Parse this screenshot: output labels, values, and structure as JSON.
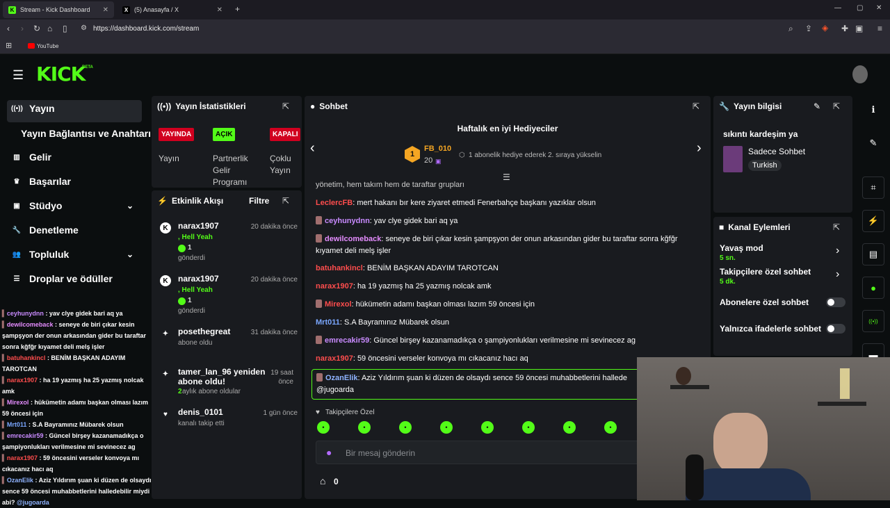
{
  "browser": {
    "tabs": [
      {
        "label": "Stream - Kick Dashboard",
        "fav": "K"
      },
      {
        "label": "(5) Anasayfa / X",
        "fav": "X"
      }
    ],
    "url": "https://dashboard.kick.com/stream",
    "bookmark": "YouTube"
  },
  "logo": "KICK",
  "logo_beta": "BETA",
  "nav": [
    {
      "label": "Yayın",
      "icon": "broadcast-icon"
    },
    {
      "label": "Yayın Bağlantısı ve Anahtarı",
      "icon": ""
    },
    {
      "label": "Gelir",
      "icon": "chart-icon"
    },
    {
      "label": "Başarılar",
      "icon": "trophy-icon"
    },
    {
      "label": "Stüdyo",
      "icon": "studio-icon"
    },
    {
      "label": "Denetleme",
      "icon": "wrench-icon"
    },
    {
      "label": "Topluluk",
      "icon": "people-icon"
    },
    {
      "label": "Droplar ve ödüller",
      "icon": "drops-icon"
    }
  ],
  "side_chat": [
    {
      "name": "ceyhunydnn",
      "text": " : yav clye gidek bari aq ya",
      "color": "u-purple"
    },
    {
      "name": "dewilcomeback",
      "text": " : seneye de biri çıkar kesin şampşyon der onun arkasından gider bu taraftar sonra kğfğr kıyamet deli melş işler",
      "color": "u-pink"
    },
    {
      "name": "batuhankincl",
      "text": " : BENİM BAŞKAN ADAYIM TAROTCAN",
      "color": "u-red"
    },
    {
      "name": "narax1907",
      "text": " : ha 19 yazmış ha 25 yazmış nolcak amk",
      "color": "u-red"
    },
    {
      "name": "Mirexol",
      "text": " : hükümetin adamı başkan olması lazım 59 öncesi için",
      "color": "u-pink"
    },
    {
      "name": "Mrt011",
      "text": " : S.A Bayramınız Mübarek olsun",
      "color": "u-blue"
    },
    {
      "name": "emrecakir59",
      "text": " : Güncel birşey kazanamadıkça o şampiyonlukları verilmesine mi sevinecez ag",
      "color": "u-purple"
    },
    {
      "name": "narax1907",
      "text": " : 59 öncesini verseler konvoya mı cıkacanız hacı aq",
      "color": "u-red"
    },
    {
      "name": "OzanElik",
      "text": " : Aziz Yıldırım şuan ki düzen de olsaydı sence 59 öncesi muhabbetlerini halledebilir miydi abi? ",
      "mention": "@jugoarda",
      "color": "u-cyan"
    }
  ],
  "stats": {
    "title": "Yayın İstatistikleri",
    "items": [
      {
        "badge": "YAYINDA",
        "label": "Yayın",
        "color": "#d1001f"
      },
      {
        "badge": "AÇIK",
        "label": "Partnerlik Gelir Programı",
        "color": "#53fc18"
      },
      {
        "badge": "KAPALI",
        "label": "Çoklu Yayın",
        "color": "#d1001f"
      }
    ]
  },
  "activity": {
    "title": "Etkinlik Akışı",
    "filter": "Filtre",
    "items": [
      {
        "user": "narax1907",
        "msg": ", Hell Yeah",
        "count": "1",
        "action": "gönderdi",
        "time": "20 dakika önce",
        "icon": "kick-icon"
      },
      {
        "user": "narax1907",
        "msg": ", Hell Yeah",
        "count": "1",
        "action": "gönderdi",
        "time": "20 dakika önce",
        "icon": "kick-icon"
      },
      {
        "user": "posethegreat",
        "msg": "",
        "count": "",
        "action": "abone oldu",
        "time": "31 dakika önce",
        "icon": "sparkle-icon"
      },
      {
        "user": "tamer_lan_96 yeniden abone oldu!",
        "msg": "",
        "count": "2",
        "action": " aylık abone oldular",
        "time": "19 saat önce",
        "icon": "sparkle-icon"
      },
      {
        "user": "denis_0101",
        "msg": "",
        "count": "",
        "action": "kanalı takip etti",
        "time": "1 gün önce",
        "icon": "heart-icon"
      }
    ]
  },
  "chat": {
    "title": "Sohbet",
    "gifters_title": "Haftalık en iyi Hediyeciler",
    "top_gifter": "FB_010",
    "top_rank": "1",
    "top_count": "20",
    "gift_hint": "1 abonelik hediye ederek 2. sıraya yükselin",
    "cut_line": "yönetim, hem takım hem de taraftar grupları",
    "messages": [
      {
        "name": "LeclercFB",
        "text": ": mert hakanı bır kere ziyaret etmedi Fenerbahçe başkanı yazıklar olsun",
        "color": "u-red",
        "badge": false
      },
      {
        "name": "ceyhunydnn",
        "text": ": yav clye gidek bari aq ya",
        "color": "u-purple",
        "badge": true
      },
      {
        "name": "dewilcomeback",
        "text": ": seneye de biri çıkar kesin şampşyon der onun arkasından gider bu taraftar sonra kğfğr kıyamet deli melş işler",
        "color": "u-pink",
        "badge": true
      },
      {
        "name": "batuhankincl",
        "text": ": BENİM BAŞKAN ADAYIM TAROTCAN",
        "color": "u-red",
        "badge": false
      },
      {
        "name": "narax1907",
        "text": ": ha 19 yazmış ha 25 yazmış nolcak amk",
        "color": "u-red",
        "badge": false
      },
      {
        "name": "Mirexol",
        "text": ": hükümetin adamı başkan olması lazım 59 öncesi için",
        "color": "u-red",
        "badge": true
      },
      {
        "name": "Mrt011",
        "text": ": S.A Bayramınız Mübarek olsun",
        "color": "u-blue",
        "badge": false
      },
      {
        "name": "emrecakir59",
        "text": ": Güncel birşey kazanamadıkça o şampiyonlukları verilmesine mi sevinecez ag",
        "color": "u-purple",
        "badge": true
      },
      {
        "name": "narax1907",
        "text": ": 59 öncesini verseler konvoya mı cıkacanız hacı aq",
        "color": "u-red",
        "badge": false
      }
    ],
    "highlight": {
      "name": "OzanElik",
      "text": ": Aziz Yıldırım şuan ki düzen de olsaydı sence 59 öncesi muhabbetlerini hallede",
      "mention": "@jugoarda"
    },
    "emote_tab": "Takipçilere Özel",
    "input_placeholder": "Bir mesaj gönderin",
    "points": "0"
  },
  "stream_info": {
    "title": "Yayın bilgisi",
    "stream_title": "sıkıntı kardeşim ya",
    "category": "Sadece Sohbet",
    "tag": "Turkish"
  },
  "channel_actions": {
    "title": "Kanal Eylemleri",
    "items": [
      {
        "label": "Yavaş mod",
        "value": "5 sn."
      },
      {
        "label": "Takipçilere özel sohbet",
        "value": "5 dk."
      },
      {
        "label": "Abonelere özel sohbet",
        "value": ""
      },
      {
        "label": "Yalnızca ifadelerle sohbet",
        "value": ""
      }
    ]
  },
  "colors": {
    "accent": "#53fc18",
    "live": "#d1001f",
    "panel": "#191b1f"
  }
}
